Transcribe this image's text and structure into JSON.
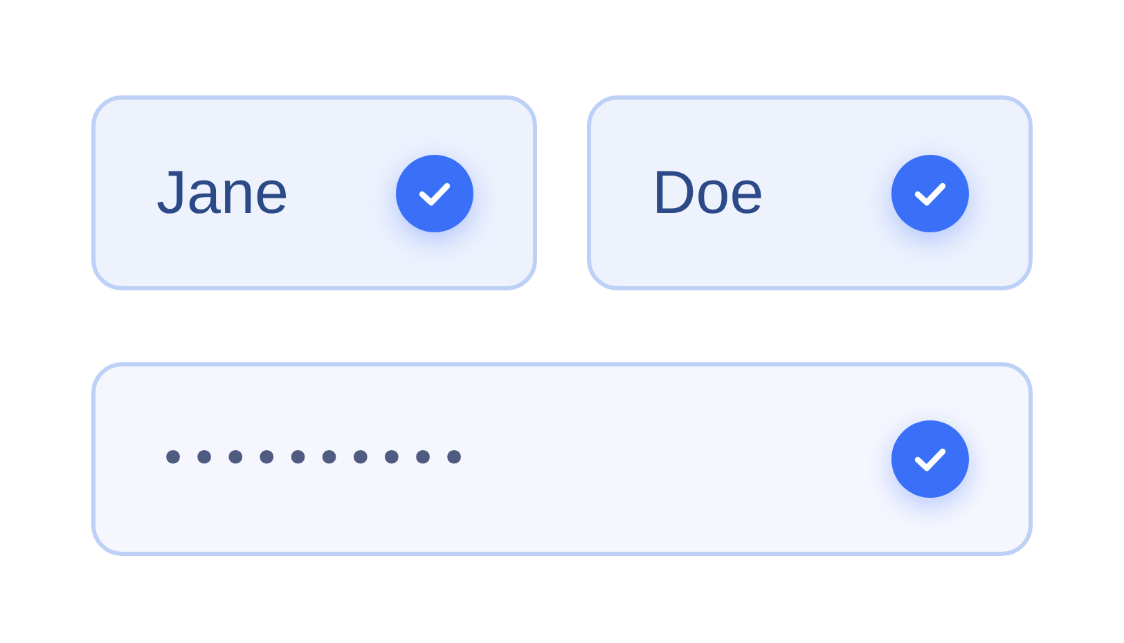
{
  "fields": [
    {
      "kind": "text",
      "value": "Jane",
      "valid": true
    },
    {
      "kind": "text",
      "value": "Doe",
      "valid": true
    },
    {
      "kind": "password",
      "value": "••••••••••",
      "valid": true
    }
  ]
}
